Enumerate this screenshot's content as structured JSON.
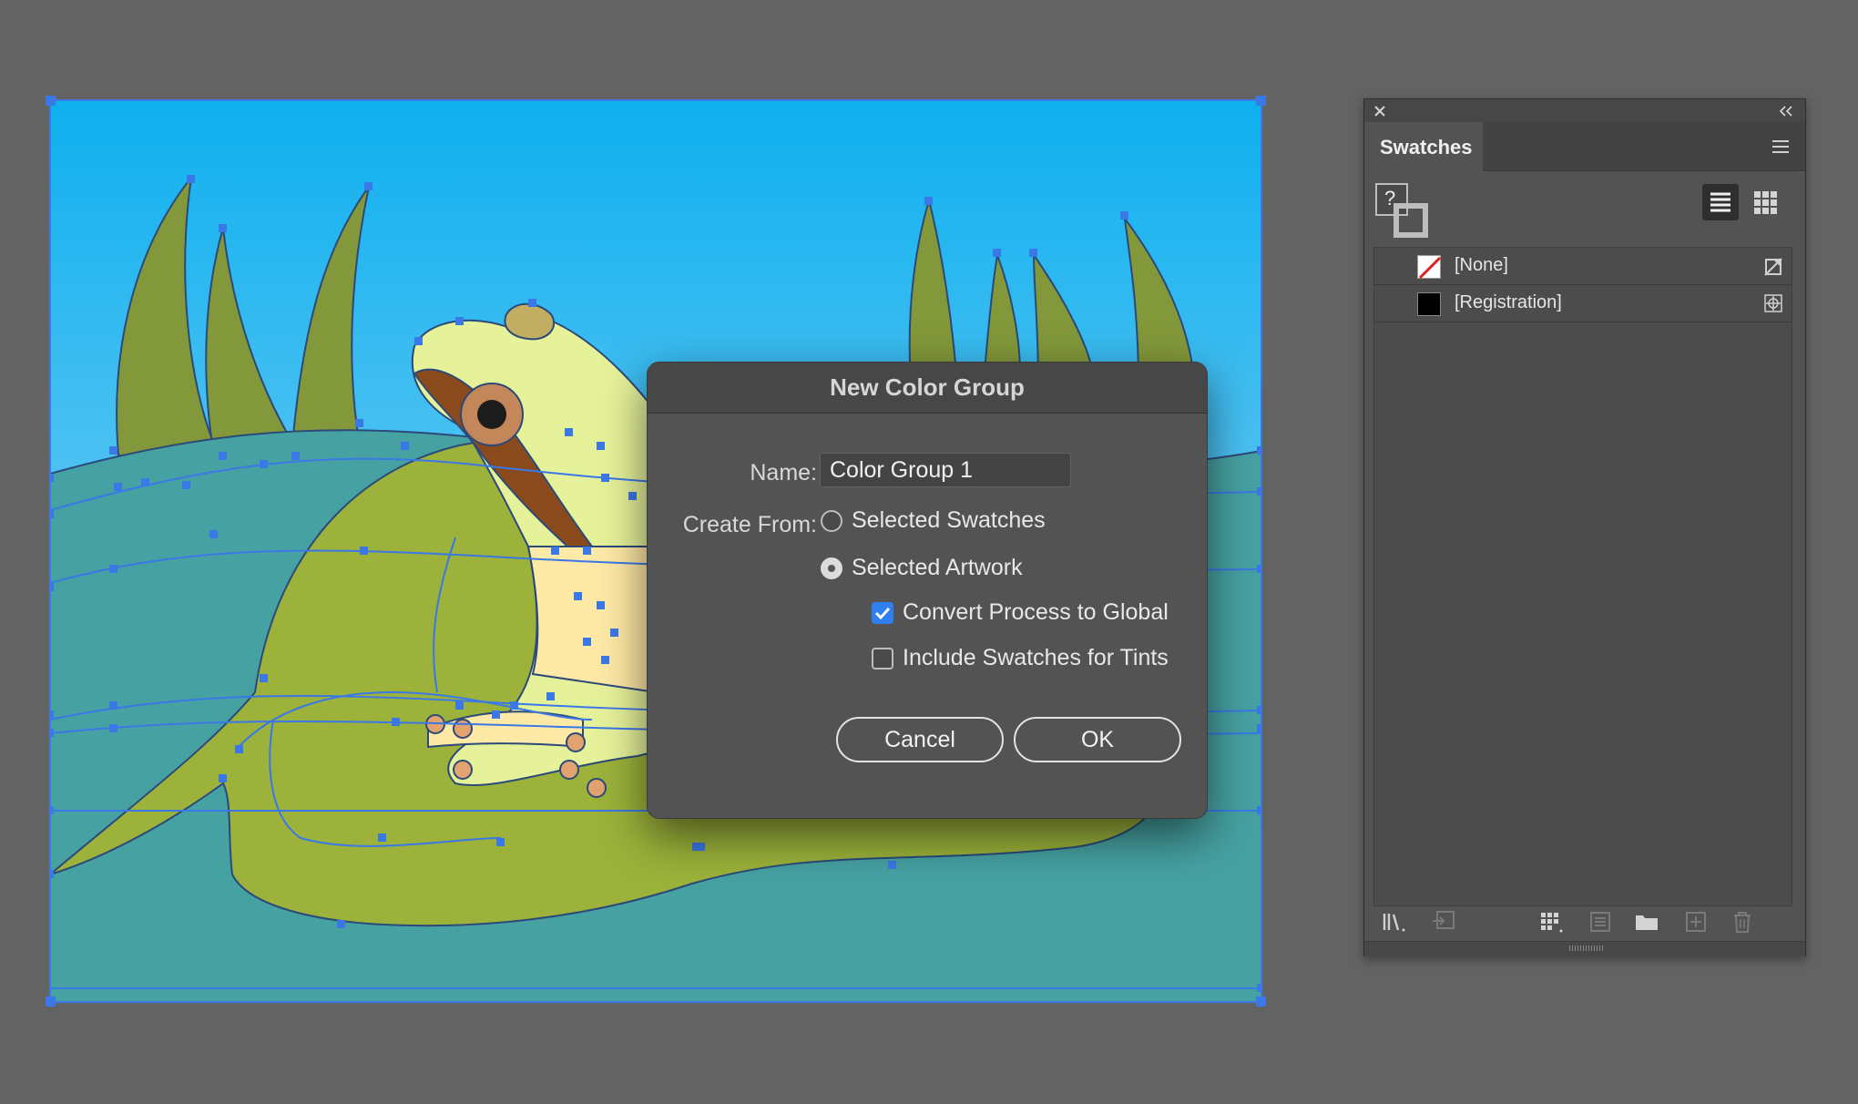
{
  "dialog": {
    "title": "New Color Group",
    "name_label": "Name:",
    "name_value": "Color Group 1",
    "create_from_label": "Create From:",
    "options": [
      {
        "label": "Selected Swatches",
        "selected": false
      },
      {
        "label": "Selected Artwork",
        "selected": true
      }
    ],
    "checkboxes": [
      {
        "label": "Convert Process to Global",
        "checked": true
      },
      {
        "label": "Include Swatches for Tints",
        "checked": false
      }
    ],
    "cancel_label": "Cancel",
    "ok_label": "OK"
  },
  "panel": {
    "tab_label": "Swatches",
    "swatches": [
      {
        "label": "[None]",
        "color": "none"
      },
      {
        "label": "[Registration]",
        "color": "#000000"
      }
    ],
    "fill_stroke_glyph": "?"
  },
  "colors": {
    "sky_top": "#0fb0ef",
    "sky_bottom": "#9ad6f5",
    "reed": "#83983a",
    "water": "#46a1a2",
    "lily_pad": "#9cb23a",
    "frog_body": "#e6f29a",
    "frog_stripe": "#8b4a1b",
    "anchor_blue": "#3b78e7",
    "accent_checkbox": "#2f7ff0"
  }
}
